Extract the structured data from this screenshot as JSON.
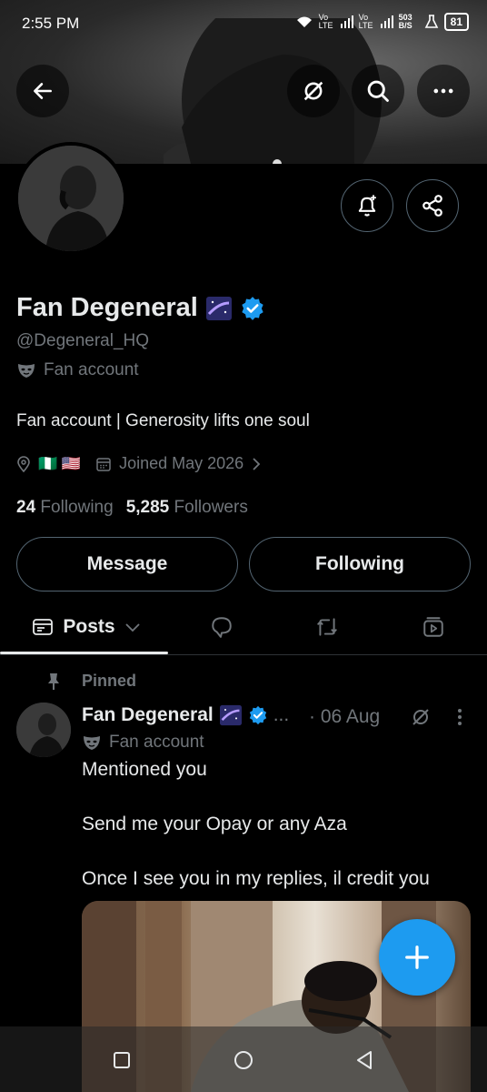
{
  "status_bar": {
    "time": "2:55 PM",
    "net1": "Vo LTE",
    "net2": "Vo LTE",
    "speed": "503 B/S",
    "battery": "81"
  },
  "profile": {
    "display_name": "Fan Degeneral",
    "handle": "@Degeneral_HQ",
    "category": "Fan account",
    "bio": "Fan account | Generosity lifts one soul",
    "flags": "🇳🇬 🇺🇸",
    "joined": "Joined May 2026",
    "following_count": "24",
    "following_label": "Following",
    "followers_count": "5,285",
    "followers_label": "Followers",
    "verified_color": "#1d9bf0"
  },
  "actions": {
    "message_label": "Message",
    "following_label": "Following"
  },
  "tabs": {
    "posts_label": "Posts"
  },
  "post": {
    "pinned_label": "Pinned",
    "author": "Fan Degeneral",
    "ellipsis": "...",
    "date": "· 06 Aug",
    "category": "Fan account",
    "line1": "Mentioned you",
    "line2": "Send me your Opay or any Aza",
    "line3": "Once I see you in my replies, il credit you"
  },
  "icons": {
    "back": "back-arrow-icon",
    "grok": "grok-icon",
    "search": "search-icon",
    "more": "more-icon",
    "notify": "bell-plus-icon",
    "share": "share-icon",
    "compose": "plus-icon"
  },
  "colors": {
    "accent": "#1d9bf0",
    "muted": "#71767b",
    "text": "#e7e9ea",
    "border": "#536471"
  }
}
